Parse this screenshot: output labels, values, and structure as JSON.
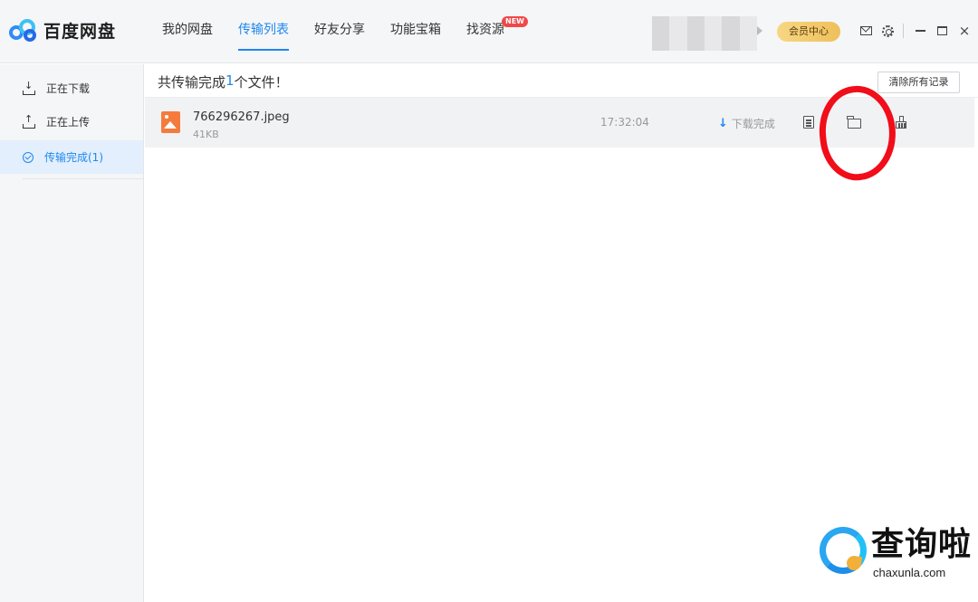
{
  "app": {
    "name": "百度网盘"
  },
  "nav": {
    "items": [
      {
        "label": "我的网盘"
      },
      {
        "label": "传输列表",
        "active": true
      },
      {
        "label": "好友分享"
      },
      {
        "label": "功能宝箱"
      },
      {
        "label": "找资源",
        "badge": "NEW"
      }
    ]
  },
  "titlebar": {
    "vip_label": "会员中心",
    "icons": [
      "mail-icon",
      "gear-icon",
      "minimize-icon",
      "maximize-icon",
      "close-icon"
    ],
    "close_glyph": "×"
  },
  "sidebar": {
    "items": [
      {
        "label": "正在下载",
        "icon": "download-icon"
      },
      {
        "label": "正在上传",
        "icon": "upload-icon"
      },
      {
        "label": "传输完成(1)",
        "icon": "check-circle-icon",
        "active": true
      }
    ]
  },
  "main": {
    "summary_prefix": "共传输完成",
    "summary_count": "1",
    "summary_suffix": "个文件！",
    "clear_button": "清除所有记录",
    "files": [
      {
        "name": "766296267.jpeg",
        "size": "41KB",
        "time": "17:32:04",
        "status": "下载完成",
        "status_icon": "download-arrow-icon",
        "actions": [
          "document-icon",
          "folder-icon",
          "clean-icon"
        ]
      }
    ]
  },
  "watermark": {
    "text": "查询啦",
    "url": "chaxunla.com"
  },
  "colors": {
    "accent": "#1f87f0",
    "file_icon": "#f57b3d",
    "annotation": "#f10d19",
    "vip_gold": "#eec05a"
  }
}
